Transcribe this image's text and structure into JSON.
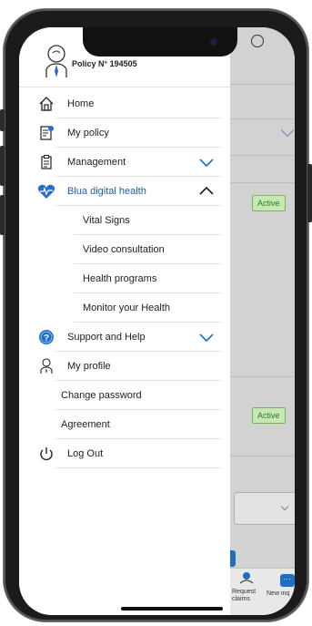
{
  "header": {
    "policy_text": "Policy N° 194505"
  },
  "menu": {
    "items": [
      {
        "label": "Home"
      },
      {
        "label": "My policy"
      },
      {
        "label": "Management"
      },
      {
        "label": "Blua digital health"
      },
      {
        "label": "Vital Signs"
      },
      {
        "label": "Video consultation"
      },
      {
        "label": "Health programs"
      },
      {
        "label": "Monitor your Health"
      },
      {
        "label": "Support and Help"
      },
      {
        "label": "My profile"
      },
      {
        "label": "Change password"
      },
      {
        "label": "Agreement"
      },
      {
        "label": "Log Out"
      }
    ]
  },
  "background": {
    "badge_1": "Active",
    "badge_2": "Active",
    "bottom_left_label": "Request claims",
    "bottom_right_label": "New inq"
  },
  "colors": {
    "accent": "#1f6ec2",
    "health_icon": "#2470c8",
    "badge_bg": "#c6e8b4",
    "badge_text": "#2e7a25"
  }
}
